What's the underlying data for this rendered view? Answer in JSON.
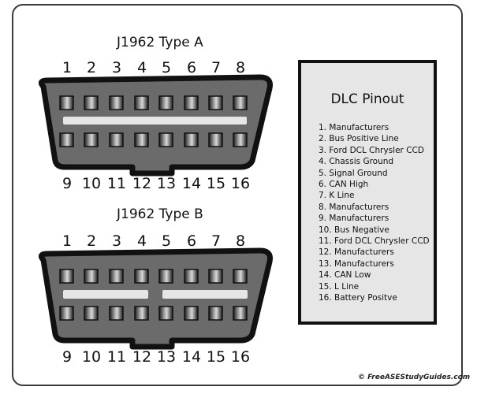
{
  "connectors": [
    {
      "title": "J1962 Type A",
      "top_pins": [
        "1",
        "2",
        "3",
        "4",
        "5",
        "6",
        "7",
        "8"
      ],
      "bottom_pins": [
        "9",
        "10",
        "11",
        "12",
        "13",
        "14",
        "15",
        "16"
      ],
      "divider": "single"
    },
    {
      "title": "J1962 Type B",
      "top_pins": [
        "1",
        "2",
        "3",
        "4",
        "5",
        "6",
        "7",
        "8"
      ],
      "bottom_pins": [
        "9",
        "10",
        "11",
        "12",
        "13",
        "14",
        "15",
        "16"
      ],
      "divider": "split"
    }
  ],
  "pinout": {
    "title": "DLC Pinout",
    "items": [
      "1. Manufacturers",
      "2. Bus Positive Line",
      "3. Ford DCL Chrysler CCD",
      "4. Chassis Ground",
      "5. Signal Ground",
      "6. CAN High",
      "7. K Line",
      "8. Manufacturers",
      "9. Manufacturers",
      "10. Bus Negative",
      "11. Ford DCL Chrysler CCD",
      "12. Manufacturers",
      "13. Manufacturers",
      "14. CAN Low",
      "15. L Line",
      "16. Battery Positve"
    ]
  },
  "copyright": "© FreeASEStudyGuides.com",
  "colors": {
    "connector_body": "#6b6b6b",
    "connector_outline": "#111111",
    "divider": "#e6e6e6",
    "panel_bg": "#e6e6e6"
  }
}
